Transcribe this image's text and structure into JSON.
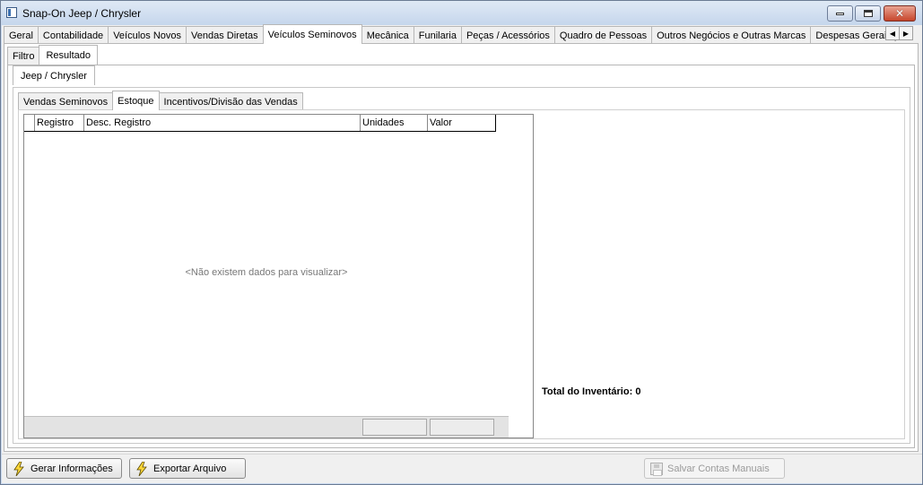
{
  "window": {
    "title": "Snap-On Jeep / Chrysler"
  },
  "top_tabs": [
    "Geral",
    "Contabilidade",
    "Veículos Novos",
    "Vendas Diretas",
    "Veículos Seminovos",
    "Mecânica",
    "Funilaria",
    "Peças / Acessórios",
    "Quadro de Pessoas",
    "Outros Negócios e Outras Marcas",
    "Despesas Gerais por l"
  ],
  "top_tabs_active": "Veículos Seminovos",
  "sub_tabs": [
    "Filtro",
    "Resultado"
  ],
  "sub_tabs_active": "Resultado",
  "brand_tabs": [
    "Jeep / Chrysler"
  ],
  "section_tabs": [
    "Vendas Seminovos",
    "Estoque",
    "Incentivos/Divisão das Vendas"
  ],
  "section_tabs_active": "Estoque",
  "grid": {
    "columns": [
      "Registro",
      "Desc. Registro",
      "Unidades",
      "Valor"
    ],
    "empty_message": "<Não existem dados para visualizar>"
  },
  "summary": {
    "total_label": "Total do Inventário:",
    "total_value": "0"
  },
  "buttons": {
    "gerar": "Gerar Informações",
    "exportar": "Exportar Arquivo",
    "salvar": "Salvar Contas Manuais"
  }
}
